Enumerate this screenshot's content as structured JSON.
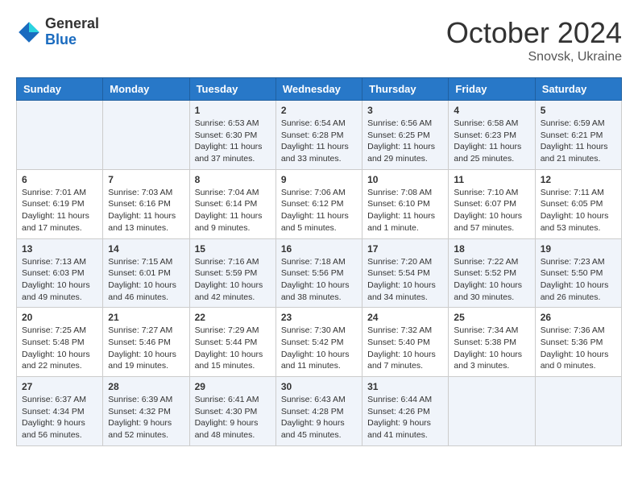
{
  "logo": {
    "general": "General",
    "blue": "Blue"
  },
  "title": "October 2024",
  "subtitle": "Snovsk, Ukraine",
  "days_header": [
    "Sunday",
    "Monday",
    "Tuesday",
    "Wednesday",
    "Thursday",
    "Friday",
    "Saturday"
  ],
  "weeks": [
    [
      {
        "day": "",
        "sunrise": "",
        "sunset": "",
        "daylight": ""
      },
      {
        "day": "",
        "sunrise": "",
        "sunset": "",
        "daylight": ""
      },
      {
        "day": "1",
        "sunrise": "Sunrise: 6:53 AM",
        "sunset": "Sunset: 6:30 PM",
        "daylight": "Daylight: 11 hours and 37 minutes."
      },
      {
        "day": "2",
        "sunrise": "Sunrise: 6:54 AM",
        "sunset": "Sunset: 6:28 PM",
        "daylight": "Daylight: 11 hours and 33 minutes."
      },
      {
        "day": "3",
        "sunrise": "Sunrise: 6:56 AM",
        "sunset": "Sunset: 6:25 PM",
        "daylight": "Daylight: 11 hours and 29 minutes."
      },
      {
        "day": "4",
        "sunrise": "Sunrise: 6:58 AM",
        "sunset": "Sunset: 6:23 PM",
        "daylight": "Daylight: 11 hours and 25 minutes."
      },
      {
        "day": "5",
        "sunrise": "Sunrise: 6:59 AM",
        "sunset": "Sunset: 6:21 PM",
        "daylight": "Daylight: 11 hours and 21 minutes."
      }
    ],
    [
      {
        "day": "6",
        "sunrise": "Sunrise: 7:01 AM",
        "sunset": "Sunset: 6:19 PM",
        "daylight": "Daylight: 11 hours and 17 minutes."
      },
      {
        "day": "7",
        "sunrise": "Sunrise: 7:03 AM",
        "sunset": "Sunset: 6:16 PM",
        "daylight": "Daylight: 11 hours and 13 minutes."
      },
      {
        "day": "8",
        "sunrise": "Sunrise: 7:04 AM",
        "sunset": "Sunset: 6:14 PM",
        "daylight": "Daylight: 11 hours and 9 minutes."
      },
      {
        "day": "9",
        "sunrise": "Sunrise: 7:06 AM",
        "sunset": "Sunset: 6:12 PM",
        "daylight": "Daylight: 11 hours and 5 minutes."
      },
      {
        "day": "10",
        "sunrise": "Sunrise: 7:08 AM",
        "sunset": "Sunset: 6:10 PM",
        "daylight": "Daylight: 11 hours and 1 minute."
      },
      {
        "day": "11",
        "sunrise": "Sunrise: 7:10 AM",
        "sunset": "Sunset: 6:07 PM",
        "daylight": "Daylight: 10 hours and 57 minutes."
      },
      {
        "day": "12",
        "sunrise": "Sunrise: 7:11 AM",
        "sunset": "Sunset: 6:05 PM",
        "daylight": "Daylight: 10 hours and 53 minutes."
      }
    ],
    [
      {
        "day": "13",
        "sunrise": "Sunrise: 7:13 AM",
        "sunset": "Sunset: 6:03 PM",
        "daylight": "Daylight: 10 hours and 49 minutes."
      },
      {
        "day": "14",
        "sunrise": "Sunrise: 7:15 AM",
        "sunset": "Sunset: 6:01 PM",
        "daylight": "Daylight: 10 hours and 46 minutes."
      },
      {
        "day": "15",
        "sunrise": "Sunrise: 7:16 AM",
        "sunset": "Sunset: 5:59 PM",
        "daylight": "Daylight: 10 hours and 42 minutes."
      },
      {
        "day": "16",
        "sunrise": "Sunrise: 7:18 AM",
        "sunset": "Sunset: 5:56 PM",
        "daylight": "Daylight: 10 hours and 38 minutes."
      },
      {
        "day": "17",
        "sunrise": "Sunrise: 7:20 AM",
        "sunset": "Sunset: 5:54 PM",
        "daylight": "Daylight: 10 hours and 34 minutes."
      },
      {
        "day": "18",
        "sunrise": "Sunrise: 7:22 AM",
        "sunset": "Sunset: 5:52 PM",
        "daylight": "Daylight: 10 hours and 30 minutes."
      },
      {
        "day": "19",
        "sunrise": "Sunrise: 7:23 AM",
        "sunset": "Sunset: 5:50 PM",
        "daylight": "Daylight: 10 hours and 26 minutes."
      }
    ],
    [
      {
        "day": "20",
        "sunrise": "Sunrise: 7:25 AM",
        "sunset": "Sunset: 5:48 PM",
        "daylight": "Daylight: 10 hours and 22 minutes."
      },
      {
        "day": "21",
        "sunrise": "Sunrise: 7:27 AM",
        "sunset": "Sunset: 5:46 PM",
        "daylight": "Daylight: 10 hours and 19 minutes."
      },
      {
        "day": "22",
        "sunrise": "Sunrise: 7:29 AM",
        "sunset": "Sunset: 5:44 PM",
        "daylight": "Daylight: 10 hours and 15 minutes."
      },
      {
        "day": "23",
        "sunrise": "Sunrise: 7:30 AM",
        "sunset": "Sunset: 5:42 PM",
        "daylight": "Daylight: 10 hours and 11 minutes."
      },
      {
        "day": "24",
        "sunrise": "Sunrise: 7:32 AM",
        "sunset": "Sunset: 5:40 PM",
        "daylight": "Daylight: 10 hours and 7 minutes."
      },
      {
        "day": "25",
        "sunrise": "Sunrise: 7:34 AM",
        "sunset": "Sunset: 5:38 PM",
        "daylight": "Daylight: 10 hours and 3 minutes."
      },
      {
        "day": "26",
        "sunrise": "Sunrise: 7:36 AM",
        "sunset": "Sunset: 5:36 PM",
        "daylight": "Daylight: 10 hours and 0 minutes."
      }
    ],
    [
      {
        "day": "27",
        "sunrise": "Sunrise: 6:37 AM",
        "sunset": "Sunset: 4:34 PM",
        "daylight": "Daylight: 9 hours and 56 minutes."
      },
      {
        "day": "28",
        "sunrise": "Sunrise: 6:39 AM",
        "sunset": "Sunset: 4:32 PM",
        "daylight": "Daylight: 9 hours and 52 minutes."
      },
      {
        "day": "29",
        "sunrise": "Sunrise: 6:41 AM",
        "sunset": "Sunset: 4:30 PM",
        "daylight": "Daylight: 9 hours and 48 minutes."
      },
      {
        "day": "30",
        "sunrise": "Sunrise: 6:43 AM",
        "sunset": "Sunset: 4:28 PM",
        "daylight": "Daylight: 9 hours and 45 minutes."
      },
      {
        "day": "31",
        "sunrise": "Sunrise: 6:44 AM",
        "sunset": "Sunset: 4:26 PM",
        "daylight": "Daylight: 9 hours and 41 minutes."
      },
      {
        "day": "",
        "sunrise": "",
        "sunset": "",
        "daylight": ""
      },
      {
        "day": "",
        "sunrise": "",
        "sunset": "",
        "daylight": ""
      }
    ]
  ]
}
